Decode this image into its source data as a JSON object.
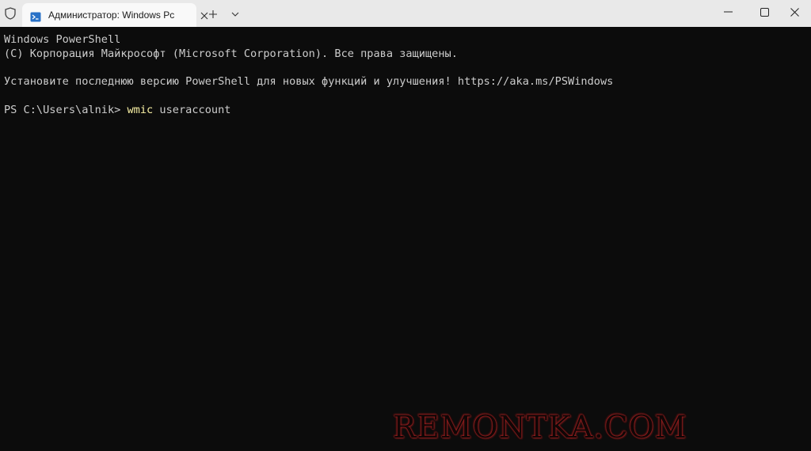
{
  "window": {
    "tab_title": "Администратор: Windows Pc",
    "buttons": {
      "minimize": "—",
      "maximize": "☐",
      "close": "✕"
    },
    "new_tab": "+",
    "tab_close": "✕"
  },
  "terminal": {
    "line1": "Windows PowerShell",
    "line2": "(C) Корпорация Майкрософт (Microsoft Corporation). Все права защищены.",
    "line3": "Установите последнюю версию PowerShell для новых функций и улучшения! https://aka.ms/PSWindows",
    "prompt": "PS C:\\Users\\alnik> ",
    "command": "wmic",
    "command_args": " useraccount"
  },
  "watermark": "REMONTKA.COM",
  "colors": {
    "titlebar": "#e9e9e9",
    "tab": "#f9f9f9",
    "terminal_bg": "#0c0c0c",
    "terminal_fg": "#cccccc",
    "command_fg": "#f9f1a5",
    "watermark_glow": "#b82a2a"
  }
}
